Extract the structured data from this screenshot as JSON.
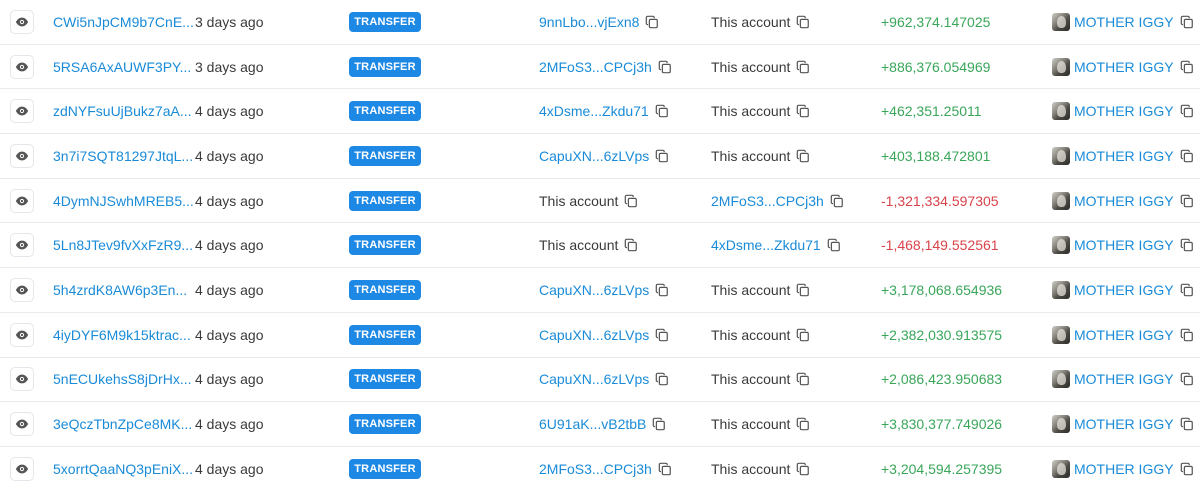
{
  "icons": {
    "view": "eye-icon",
    "copy": "copy-icon",
    "token_avatar": "token-avatar-image"
  },
  "colors": {
    "link": "#1a8bd8",
    "badge": "#1e88e5",
    "positive": "#3aa65a",
    "negative": "#d9434a"
  },
  "rows": [
    {
      "signature": "CWi5nJpCM9b7CnE...",
      "time": "3 days ago",
      "type": "TRANSFER",
      "from": "9nnLbo...vjExn8",
      "from_is_account": false,
      "to": "This account",
      "to_is_account": true,
      "amount": "+962,374.147025",
      "direction": "in",
      "token": "MOTHER IGGY"
    },
    {
      "signature": "5RSA6AxAUWF3PY...",
      "time": "3 days ago",
      "type": "TRANSFER",
      "from": "2MFoS3...CPCj3h",
      "from_is_account": false,
      "to": "This account",
      "to_is_account": true,
      "amount": "+886,376.054969",
      "direction": "in",
      "token": "MOTHER IGGY"
    },
    {
      "signature": "zdNYFsuUjBukz7aA...",
      "time": "4 days ago",
      "type": "TRANSFER",
      "from": "4xDsme...Zkdu71",
      "from_is_account": false,
      "to": "This account",
      "to_is_account": true,
      "amount": "+462,351.25011",
      "direction": "in",
      "token": "MOTHER IGGY"
    },
    {
      "signature": "3n7i7SQT81297JtqL...",
      "time": "4 days ago",
      "type": "TRANSFER",
      "from": "CapuXN...6zLVps",
      "from_is_account": false,
      "to": "This account",
      "to_is_account": true,
      "amount": "+403,188.472801",
      "direction": "in",
      "token": "MOTHER IGGY"
    },
    {
      "signature": "4DymNJSwhMREB5...",
      "time": "4 days ago",
      "type": "TRANSFER",
      "from": "This account",
      "from_is_account": true,
      "to": "2MFoS3...CPCj3h",
      "to_is_account": false,
      "amount": "-1,321,334.597305",
      "direction": "out",
      "token": "MOTHER IGGY"
    },
    {
      "signature": "5Ln8JTev9fvXxFzR9...",
      "time": "4 days ago",
      "type": "TRANSFER",
      "from": "This account",
      "from_is_account": true,
      "to": "4xDsme...Zkdu71",
      "to_is_account": false,
      "amount": "-1,468,149.552561",
      "direction": "out",
      "token": "MOTHER IGGY"
    },
    {
      "signature": "5h4zrdK8AW6p3En...",
      "time": "4 days ago",
      "type": "TRANSFER",
      "from": "CapuXN...6zLVps",
      "from_is_account": false,
      "to": "This account",
      "to_is_account": true,
      "amount": "+3,178,068.654936",
      "direction": "in",
      "token": "MOTHER IGGY"
    },
    {
      "signature": "4iyDYF6M9k15ktrac...",
      "time": "4 days ago",
      "type": "TRANSFER",
      "from": "CapuXN...6zLVps",
      "from_is_account": false,
      "to": "This account",
      "to_is_account": true,
      "amount": "+2,382,030.913575",
      "direction": "in",
      "token": "MOTHER IGGY"
    },
    {
      "signature": "5nECUkehsS8jDrHx...",
      "time": "4 days ago",
      "type": "TRANSFER",
      "from": "CapuXN...6zLVps",
      "from_is_account": false,
      "to": "This account",
      "to_is_account": true,
      "amount": "+2,086,423.950683",
      "direction": "in",
      "token": "MOTHER IGGY"
    },
    {
      "signature": "3eQczTbnZpCe8MK...",
      "time": "4 days ago",
      "type": "TRANSFER",
      "from": "6U91aK...vB2tbB",
      "from_is_account": false,
      "to": "This account",
      "to_is_account": true,
      "amount": "+3,830,377.749026",
      "direction": "in",
      "token": "MOTHER IGGY"
    },
    {
      "signature": "5xorrtQaaNQ3pEniX...",
      "time": "4 days ago",
      "type": "TRANSFER",
      "from": "2MFoS3...CPCj3h",
      "from_is_account": false,
      "to": "This account",
      "to_is_account": true,
      "amount": "+3,204,594.257395",
      "direction": "in",
      "token": "MOTHER IGGY"
    }
  ]
}
